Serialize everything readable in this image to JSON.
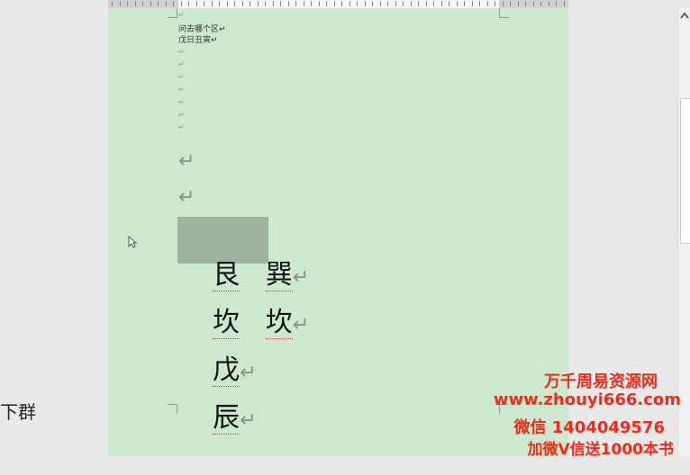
{
  "left_panel": {
    "fragment": "下群"
  },
  "document": {
    "small_lines": [
      "问去哪个区↵",
      "戊日丑寅↵"
    ],
    "small_marks": [
      "↵",
      "↵",
      "↵",
      "↵",
      "↵",
      "↵",
      "↵",
      "↵"
    ],
    "big_marks": [
      "↵",
      "↵"
    ],
    "rows": [
      {
        "left": "艮",
        "right": "巽",
        "mark": "↵"
      },
      {
        "left": "坎",
        "right": "坎",
        "mark": "↵"
      },
      {
        "left": "戊",
        "right": "",
        "mark": "↵"
      },
      {
        "left": "辰",
        "right": "",
        "mark": "↵"
      }
    ]
  },
  "watermark": {
    "line1": "万千周易资源网",
    "line2": "www.zhouyi666.com",
    "line3": "微信 1404049576",
    "line4": "加微V信送1000本书"
  },
  "colors": {
    "page_background": "#cce8cf",
    "selection": "#9fb19f",
    "watermark": "#ee2c1c"
  },
  "icons": {
    "scroll_up": "chevron-up-icon",
    "cursor": "mouse-cursor-icon"
  }
}
